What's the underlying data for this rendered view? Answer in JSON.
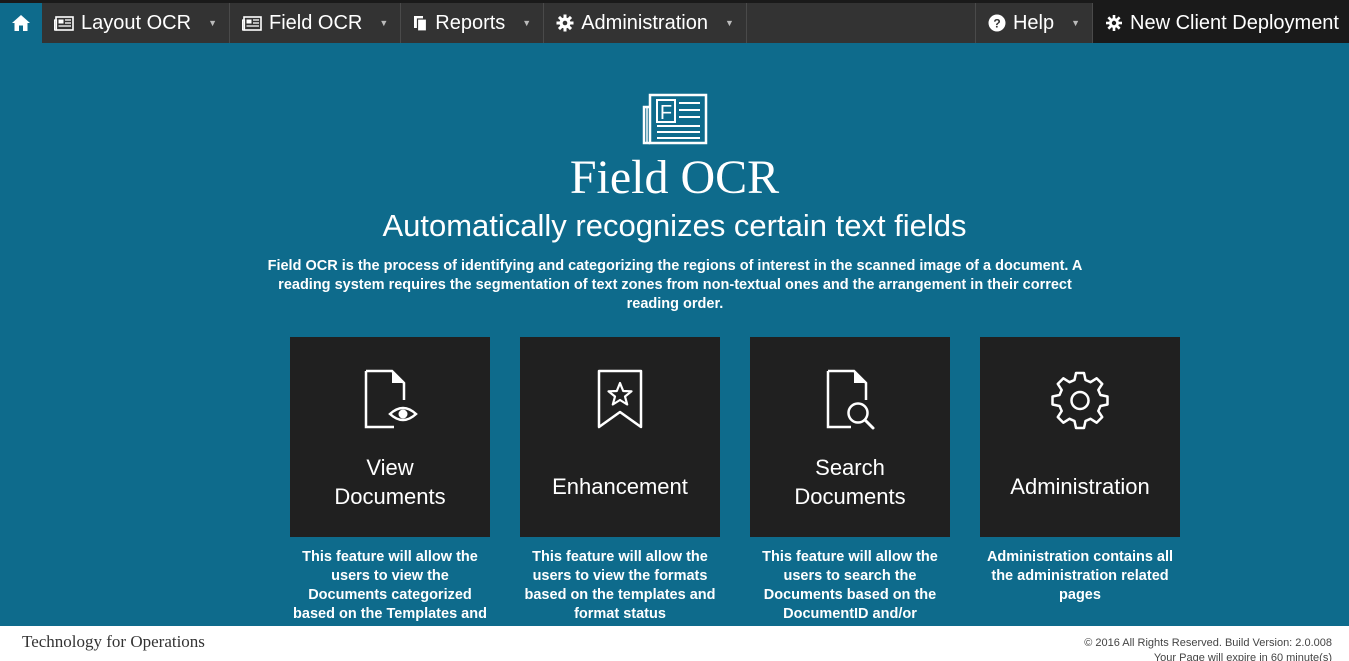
{
  "nav": {
    "items": [
      {
        "label": "Layout OCR",
        "icon": "newspaper-icon"
      },
      {
        "label": "Field OCR",
        "icon": "newspaper-icon"
      },
      {
        "label": "Reports",
        "icon": "copy-icon"
      },
      {
        "label": "Administration",
        "icon": "gear-icon"
      }
    ],
    "help": {
      "label": "Help",
      "icon": "question-circle-icon"
    },
    "deploy": {
      "label": "New Client Deployment",
      "icon": "cogs-icon"
    }
  },
  "hero": {
    "title": "Field OCR",
    "subtitle": "Automatically recognizes certain text fields",
    "description": "Field OCR is the process of identifying and categorizing the regions of interest in the scanned image of a document. A reading system requires the segmentation of text zones from non-textual ones and the arrangement in their correct reading order."
  },
  "tiles": [
    {
      "label_line1": "View",
      "label_line2": "Documents",
      "icon": "document-eye-icon",
      "description": "This feature will allow the users to view the Documents categorized based on the Templates and"
    },
    {
      "label_line1": "Enhancement",
      "label_line2": "",
      "icon": "bookmark-star-icon",
      "description": "This feature will allow the users to view the formats based on the templates and format status"
    },
    {
      "label_line1": "Search",
      "label_line2": "Documents",
      "icon": "document-search-icon",
      "description": "This feature will allow the users to search the Documents based on the DocumentID and/or"
    },
    {
      "label_line1": "Administration",
      "label_line2": "",
      "icon": "gear-icon",
      "description": "Administration contains all the administration related pages"
    }
  ],
  "footer": {
    "left": "Technology for Operations",
    "copyright": "© 2016 All Rights Reserved. Build Version: 2.0.008",
    "expiry": "Your Page will expire in 60 minute(s)"
  }
}
